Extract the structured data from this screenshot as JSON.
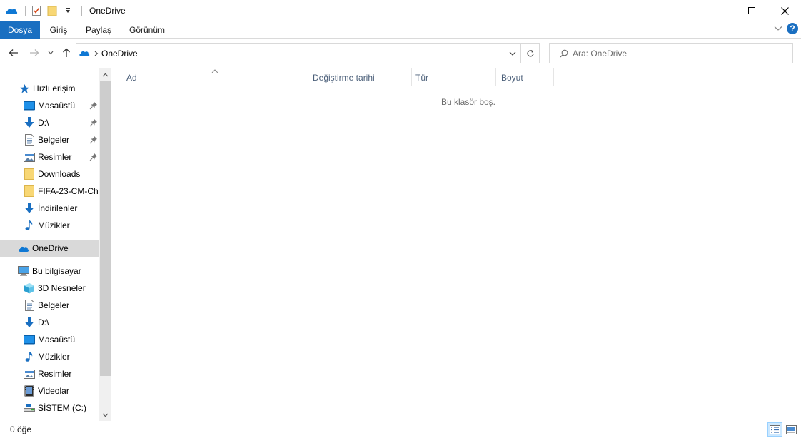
{
  "window": {
    "title": "OneDrive"
  },
  "ribbon": {
    "tabs": [
      "Dosya",
      "Giriş",
      "Paylaş",
      "Görünüm"
    ]
  },
  "navigation": {
    "address_path": "OneDrive",
    "search_placeholder": "Ara: OneDrive"
  },
  "sidebar": {
    "quick_access": {
      "label": "Hızlı erişim",
      "items": [
        {
          "label": "Masaüstü",
          "icon": "desktop-icon",
          "pinned": true
        },
        {
          "label": "D:\\",
          "icon": "download-arrow-icon",
          "pinned": true
        },
        {
          "label": "Belgeler",
          "icon": "documents-icon",
          "pinned": true
        },
        {
          "label": "Resimler",
          "icon": "pictures-icon",
          "pinned": true
        },
        {
          "label": "Downloads",
          "icon": "folder-icon",
          "pinned": false
        },
        {
          "label": "FIFA-23-CM-Che",
          "icon": "folder-icon",
          "pinned": false
        },
        {
          "label": "İndirilenler",
          "icon": "download-arrow-icon",
          "pinned": false
        },
        {
          "label": "Müzikler",
          "icon": "music-icon",
          "pinned": false
        }
      ]
    },
    "onedrive": {
      "label": "OneDrive"
    },
    "this_pc": {
      "label": "Bu bilgisayar",
      "items": [
        {
          "label": "3D Nesneler",
          "icon": "3d-objects-icon"
        },
        {
          "label": "Belgeler",
          "icon": "documents-icon"
        },
        {
          "label": "D:\\",
          "icon": "download-arrow-icon"
        },
        {
          "label": "Masaüstü",
          "icon": "desktop-icon"
        },
        {
          "label": "Müzikler",
          "icon": "music-icon"
        },
        {
          "label": "Resimler",
          "icon": "pictures-icon"
        },
        {
          "label": "Videolar",
          "icon": "videos-icon"
        },
        {
          "label": "SİSTEM (C:)",
          "icon": "drive-icon"
        }
      ]
    }
  },
  "content": {
    "columns": [
      "Ad",
      "Değiştirme tarihi",
      "Tür",
      "Boyut"
    ],
    "empty_message": "Bu klasör boş."
  },
  "status": {
    "item_count": "0 öğe"
  },
  "colors": {
    "accent": "#1a6fc1",
    "selected_bg": "#d9d9d9",
    "folder": "#f8d775",
    "onedrive": "#0f78d4"
  }
}
